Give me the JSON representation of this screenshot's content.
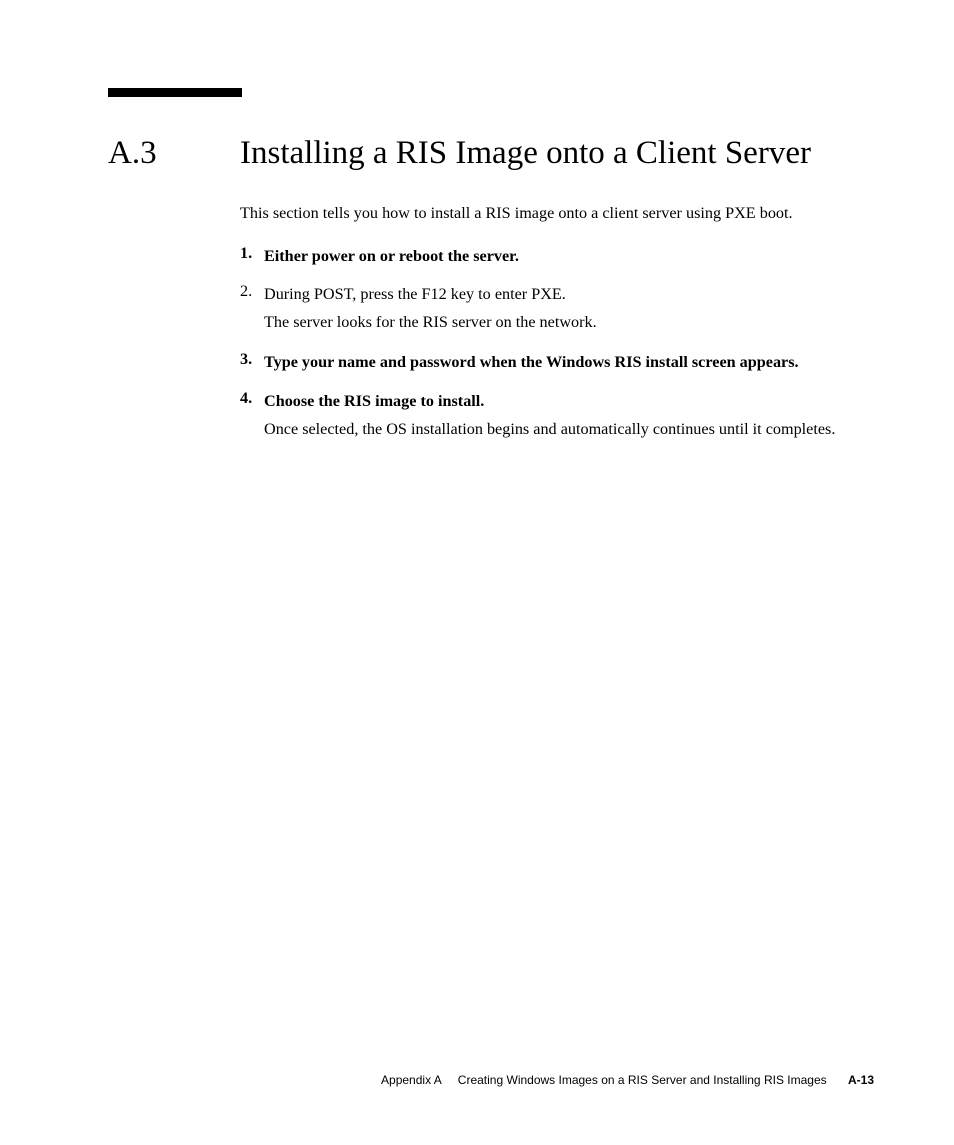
{
  "section": {
    "number": "A.3",
    "title": "Installing a RIS Image onto a Client Server"
  },
  "intro": "This section tells you how to install a RIS image onto a client server using PXE boot.",
  "steps": [
    {
      "num": "1.",
      "bold": true,
      "text": "Either power on or reboot the server.",
      "sub": ""
    },
    {
      "num": "2.",
      "bold": false,
      "text": "During POST, press the F12 key to enter PXE.",
      "sub": "The server looks for the RIS server on the network."
    },
    {
      "num": "3.",
      "bold": true,
      "text": "Type your name and password when the Windows RIS install screen appears.",
      "sub": ""
    },
    {
      "num": "4.",
      "bold": true,
      "text": "Choose the RIS image to install.",
      "sub": "Once selected, the OS installation begins and automatically continues until it completes."
    }
  ],
  "footer": {
    "appendix": "Appendix A",
    "title": "Creating Windows Images on a RIS Server and Installing RIS Images",
    "page": "A-13"
  }
}
